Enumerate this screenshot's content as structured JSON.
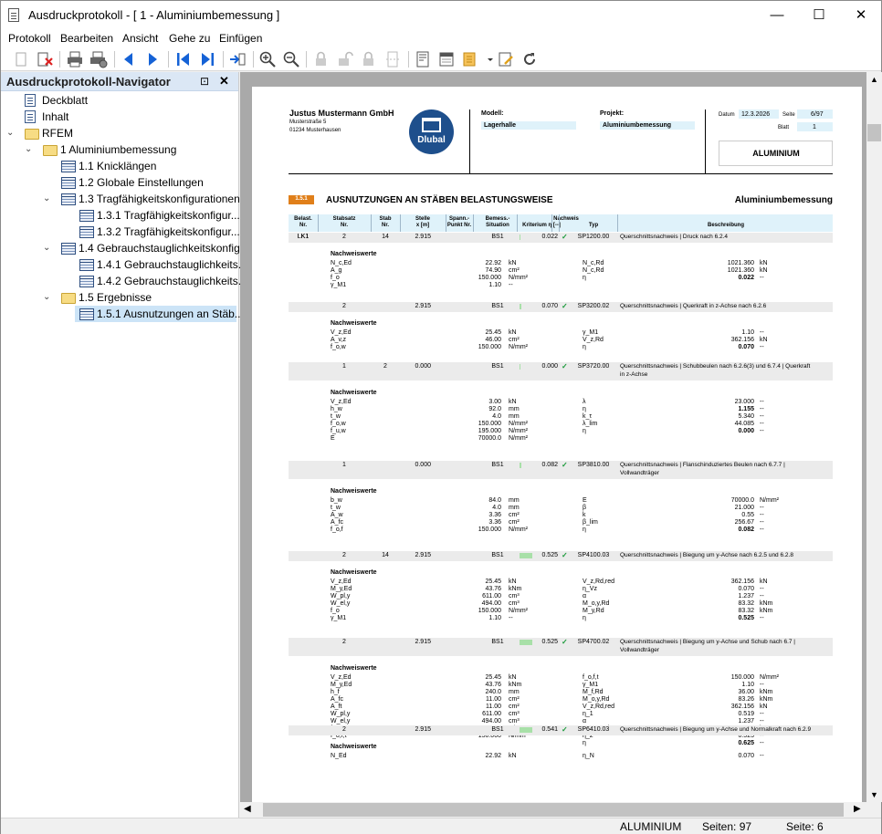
{
  "window": {
    "title": "Ausdruckprotokoll - [ 1 - Aluminiumbemessung ]",
    "minimize": "—",
    "maximize": "☐",
    "close": "✕"
  },
  "menu": [
    "Protokoll",
    "Bearbeiten",
    "Ansicht",
    "Gehe zu",
    "Einfügen"
  ],
  "navigator": {
    "title": "Ausdruckprotokoll-Navigator",
    "pin": "⊡",
    "close": "✕",
    "items": [
      {
        "label": "Deckblatt",
        "level": 0,
        "icon": "doc"
      },
      {
        "label": "Inhalt",
        "level": 0,
        "icon": "doc"
      },
      {
        "label": "RFEM",
        "level": 0,
        "icon": "folder",
        "chevron": "⌄"
      },
      {
        "label": "1 Aluminiumbemessung",
        "level": 1,
        "icon": "folder",
        "chevron": "⌄"
      },
      {
        "label": "1.1 Knicklängen",
        "level": 2,
        "icon": "table"
      },
      {
        "label": "1.2 Globale Einstellungen",
        "level": 2,
        "icon": "table"
      },
      {
        "label": "1.3 Tragfähigkeitskonfigurationen",
        "level": 2,
        "icon": "table",
        "chevron": "⌄"
      },
      {
        "label": "1.3.1 Tragfähigkeitskonfigur...",
        "level": 3,
        "icon": "table"
      },
      {
        "label": "1.3.2 Tragfähigkeitskonfigur...",
        "level": 3,
        "icon": "table"
      },
      {
        "label": "1.4 Gebrauchstauglichkeitskonfig...",
        "level": 2,
        "icon": "table",
        "chevron": "⌄"
      },
      {
        "label": "1.4.1 Gebrauchstauglichkeits...",
        "level": 3,
        "icon": "table"
      },
      {
        "label": "1.4.2 Gebrauchstauglichkeits...",
        "level": 3,
        "icon": "table"
      },
      {
        "label": "1.5 Ergebnisse",
        "level": 2,
        "icon": "folder",
        "chevron": "⌄"
      },
      {
        "label": "1.5.1 Ausnutzungen an Stäb...",
        "level": 3,
        "icon": "table",
        "selected": true
      }
    ]
  },
  "doc": {
    "company": "Justus Mustermann GmbH",
    "street": "Musterstraße 5",
    "city": "01234 Musterhausen",
    "logo": "Dlubal",
    "modell_label": "Modell:",
    "modell": "Lagerhalle",
    "projekt_label": "Projekt:",
    "projekt": "Aluminiumbemessung",
    "datum_label": "Datum",
    "datum": "12.3.2026",
    "seite_label": "Seite",
    "seite": "6/97",
    "blatt_label": "Blatt",
    "blatt": "1",
    "tag": "ALUMINIUM",
    "section_num": "1.5.1",
    "section_title": "AUSNUTZUNGEN AN STÄBEN BELASTUNGSWEISE",
    "section_right": "Aluminiumbemessung",
    "headers": {
      "belast": "Belast.",
      "belast2": "Nr.",
      "stabsatz": "Stabsatz",
      "stabsatz2": "Nr.",
      "stab": "Stab",
      "stab2": "Nr.",
      "stelle": "Stelle",
      "stelle2": "x [m]",
      "spann": "Spann.-",
      "spann2": "Punkt Nr.",
      "bemess": "Bemess.-",
      "bemess2": "Situation",
      "nachweis": "Nachweis",
      "kriterium": "Kriterium η [--]",
      "typ": "Typ",
      "beschr": "Beschreibung"
    },
    "nw_label": "Nachweiswerte",
    "rows": [
      {
        "lk": "LK1",
        "stabsatz": "2",
        "stab": "14",
        "x": "2.915",
        "sit": "BS1",
        "eta": "0.022",
        "typ": "SP1200.00",
        "desc": "Querschnittsnachweis | Druck nach 6.2.4",
        "desc2": "",
        "left": [
          [
            "N_c,Ed",
            "22.92",
            "kN"
          ],
          [
            "A_g",
            "74.90",
            "cm²"
          ],
          [
            "f_o",
            "150.000",
            "N/mm²"
          ],
          [
            "γ_M1",
            "1.10",
            "--"
          ]
        ],
        "right": [
          [
            "N_c,Rd",
            "1021.360",
            "kN"
          ],
          [
            "N_c,Rd",
            "1021.360",
            "kN"
          ],
          [
            "η",
            "0.022",
            "--"
          ]
        ]
      },
      {
        "lk": "",
        "stabsatz": "2",
        "stab": "",
        "x": "2.915",
        "sit": "BS1",
        "eta": "0.070",
        "typ": "SP3200.02",
        "desc": "Querschnittsnachweis | Querkraft in z-Achse nach 6.2.6",
        "desc2": "",
        "left": [
          [
            "V_z,Ed",
            "25.45",
            "kN"
          ],
          [
            "A_v,z",
            "46.00",
            "cm²"
          ],
          [
            "f_o,w",
            "150.000",
            "N/mm²"
          ]
        ],
        "right": [
          [
            "γ_M1",
            "1.10",
            "--"
          ],
          [
            "V_z,Rd",
            "362.156",
            "kN"
          ],
          [
            "η",
            "0.070",
            "--"
          ]
        ]
      },
      {
        "lk": "",
        "stabsatz": "1",
        "stab": "2",
        "x": "0.000",
        "sit": "BS1",
        "eta": "0.000",
        "typ": "SP3720.00",
        "desc": "Querschnittsnachweis | Schubbeulen nach 6.2.6(3) und 6.7.4 | Querkraft",
        "desc2": "in z-Achse",
        "left": [
          [
            "V_z,Ed",
            "3.00",
            "kN"
          ],
          [
            "h_w",
            "92.0",
            "mm"
          ],
          [
            "t_w",
            "4.0",
            "mm"
          ],
          [
            "f_o,w",
            "150.000",
            "N/mm²"
          ],
          [
            "f_u,w",
            "195.000",
            "N/mm²"
          ],
          [
            "E",
            "70000.0",
            "N/mm²"
          ]
        ],
        "right": [
          [
            "λ",
            "23.000",
            "--"
          ],
          [
            "η",
            "1.155",
            "--"
          ],
          [
            "k_τ",
            "5.340",
            "--"
          ],
          [
            "λ_lim",
            "44.085",
            "--"
          ],
          [
            "η",
            "0.000",
            "--"
          ]
        ]
      },
      {
        "lk": "",
        "stabsatz": "1",
        "stab": "",
        "x": "0.000",
        "sit": "BS1",
        "eta": "0.082",
        "typ": "SP3810.00",
        "desc": "Querschnittsnachweis | Flanschinduziertes Beulen nach 6.7.7 |",
        "desc2": "Vollwandträger",
        "left": [
          [
            "b_w",
            "84.0",
            "mm"
          ],
          [
            "t_w",
            "4.0",
            "mm"
          ],
          [
            "A_w",
            "3.36",
            "cm²"
          ],
          [
            "A_fc",
            "3.36",
            "cm²"
          ],
          [
            "f_o,f",
            "150.000",
            "N/mm²"
          ]
        ],
        "right": [
          [
            "E",
            "70000.0",
            "N/mm²"
          ],
          [
            "β",
            "21.000",
            "--"
          ],
          [
            "k",
            "0.55",
            "--"
          ],
          [
            "β_lim",
            "256.67",
            "--"
          ],
          [
            "η",
            "0.082",
            "--"
          ]
        ]
      },
      {
        "lk": "",
        "stabsatz": "2",
        "stab": "14",
        "x": "2.915",
        "sit": "BS1",
        "eta": "0.525",
        "typ": "SP4100.03",
        "desc": "Querschnittsnachweis | Biegung um y-Achse nach 6.2.5 und 6.2.8",
        "desc2": "",
        "left": [
          [
            "V_z,Ed",
            "25.45",
            "kN"
          ],
          [
            "M_y,Ed",
            "43.76",
            "kNm"
          ],
          [
            "W_pl,y",
            "611.00",
            "cm³"
          ],
          [
            "W_el,y",
            "494.00",
            "cm³"
          ],
          [
            "f_o",
            "150.000",
            "N/mm²"
          ],
          [
            "γ_M1",
            "1.10",
            "--"
          ]
        ],
        "right": [
          [
            "V_z,Rd,red",
            "362.156",
            "kN"
          ],
          [
            "η_Vz",
            "0.070",
            "--"
          ],
          [
            "α",
            "1.237",
            "--"
          ],
          [
            "M_o,y,Rd",
            "83.32",
            "kNm"
          ],
          [
            "M_y,Rd",
            "83.32",
            "kNm"
          ],
          [
            "η",
            "0.525",
            "--"
          ]
        ]
      },
      {
        "lk": "",
        "stabsatz": "2",
        "stab": "",
        "x": "2.915",
        "sit": "BS1",
        "eta": "0.525",
        "typ": "SP4700.02",
        "desc": "Querschnittsnachweis | Biegung um y-Achse und Schub nach 6.7 |",
        "desc2": "Vollwandträger",
        "left": [
          [
            "V_z,Ed",
            "25.45",
            "kN"
          ],
          [
            "M_y,Ed",
            "43.76",
            "kNm"
          ],
          [
            "h_f",
            "240.0",
            "mm"
          ],
          [
            "A_fc",
            "11.00",
            "cm²"
          ],
          [
            "A_ft",
            "11.00",
            "cm²"
          ],
          [
            "W_pl,y",
            "611.00",
            "cm³"
          ],
          [
            "W_el,y",
            "494.00",
            "cm³"
          ],
          [
            "f_o",
            "150.000",
            "N/mm²"
          ],
          [
            "f_o,f,t",
            "150.000",
            "N/mm²"
          ]
        ],
        "right": [
          [
            "f_o,f,t",
            "150.000",
            "N/mm²"
          ],
          [
            "γ_M1",
            "1.10",
            "--"
          ],
          [
            "M_f,Rd",
            "36.00",
            "kNm"
          ],
          [
            "M_o,y,Rd",
            "83.26",
            "kNm"
          ],
          [
            "V_z,Rd,red",
            "362.156",
            "kN"
          ],
          [
            "η_1",
            "0.519",
            "--"
          ],
          [
            "α",
            "1.237",
            "--"
          ],
          [
            "M_o,y,Rd",
            "83.32",
            "kNm"
          ],
          [
            "η_2",
            "0.525",
            "--"
          ],
          [
            "η",
            "0.625",
            "--"
          ]
        ]
      },
      {
        "lk": "",
        "stabsatz": "2",
        "stab": "",
        "x": "2.915",
        "sit": "BS1",
        "eta": "0.541",
        "typ": "SP6410.03",
        "desc": "Querschnittsnachweis | Biegung um y-Achse und Normalkraft nach 6.2.9",
        "desc2": "",
        "left": [
          [
            "N_Ed",
            "22.92",
            "kN"
          ]
        ],
        "right": [
          [
            "η_N",
            "0.070",
            "--"
          ]
        ]
      }
    ]
  },
  "status": {
    "tag": "ALUMINIUM",
    "seiten": "Seiten: 97",
    "seite": "Seite: 6"
  },
  "colors": {
    "accent": "#e07f1a",
    "nav_header": "#dbe7f5",
    "selected": "#cce4f7",
    "dlubal": "#1e4f8c"
  }
}
